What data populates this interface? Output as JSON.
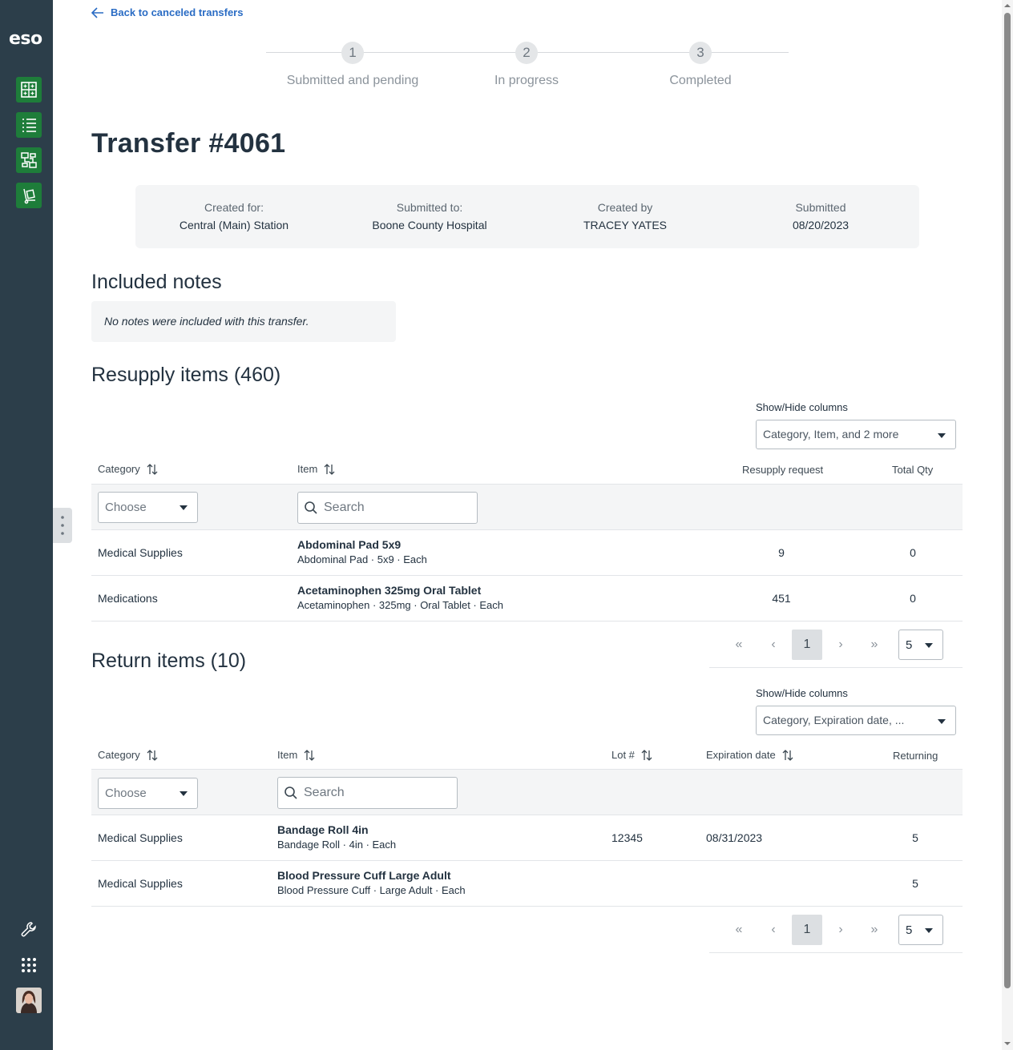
{
  "sidebar": {
    "logo": "eso"
  },
  "back_link": "Back to canceled transfers",
  "stepper": [
    {
      "num": "1",
      "label": "Submitted and pending"
    },
    {
      "num": "2",
      "label": "In progress"
    },
    {
      "num": "3",
      "label": "Completed"
    }
  ],
  "title": "Transfer #4061",
  "info": {
    "created_for_label": "Created for:",
    "created_for": "Central (Main) Station",
    "submitted_to_label": "Submitted to:",
    "submitted_to": "Boone County Hospital",
    "created_by_label": "Created by",
    "created_by": "TRACEY YATES",
    "submitted_label": "Submitted",
    "submitted": "08/20/2023"
  },
  "notes": {
    "heading": "Included notes",
    "text": "No notes were included with this transfer."
  },
  "resupply": {
    "heading": "Resupply items (460)",
    "showhide_label": "Show/Hide columns",
    "showhide_value": "Category, Item, and 2 more",
    "columns": {
      "category": "Category",
      "item": "Item",
      "request": "Resupply request",
      "total": "Total Qty"
    },
    "choose": "Choose",
    "search": "Search",
    "rows": [
      {
        "category": "Medical Supplies",
        "name": "Abdominal Pad 5x9",
        "sub": "Abdominal Pad · 5x9 · Each",
        "request": "9",
        "total": "0"
      },
      {
        "category": "Medications",
        "name": "Acetaminophen 325mg Oral Tablet",
        "sub": "Acetaminophen · 325mg · Oral Tablet · Each",
        "request": "451",
        "total": "0"
      }
    ],
    "pager": {
      "page": "1",
      "size": "5",
      "first": "«",
      "prev": "‹",
      "next": "›",
      "last": "»"
    }
  },
  "returns": {
    "heading": "Return items (10)",
    "showhide_label": "Show/Hide columns",
    "showhide_value": "Category, Expiration date, ...",
    "columns": {
      "category": "Category",
      "item": "Item",
      "lot": "Lot #",
      "exp": "Expiration date",
      "returning": "Returning"
    },
    "choose": "Choose",
    "search": "Search",
    "rows": [
      {
        "category": "Medical Supplies",
        "name": "Bandage Roll 4in",
        "sub": "Bandage Roll · 4in · Each",
        "lot": "12345",
        "exp": "08/31/2023",
        "returning": "5"
      },
      {
        "category": "Medical Supplies",
        "name": "Blood Pressure Cuff Large Adult",
        "sub": "Blood Pressure Cuff · Large Adult · Each",
        "lot": "",
        "exp": "",
        "returning": "5"
      }
    ],
    "pager": {
      "page": "1",
      "size": "5",
      "first": "«",
      "prev": "‹",
      "next": "›",
      "last": "»"
    }
  }
}
